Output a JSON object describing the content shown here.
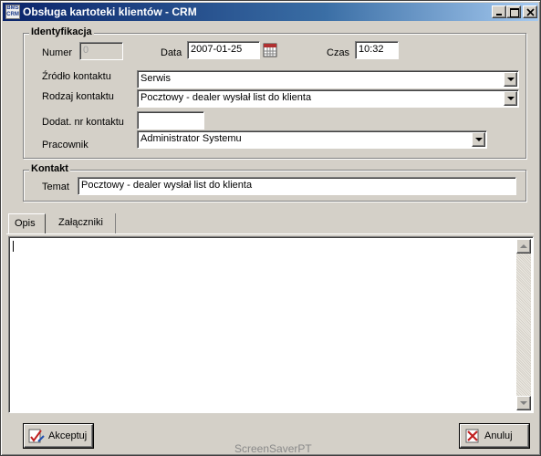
{
  "window": {
    "title": "Obsługa kartoteki klientów - CRM",
    "icon_lines": [
      "BMS",
      "CRM"
    ]
  },
  "identyfikacja": {
    "group_title": "Identyfikacja",
    "numer_label": "Numer",
    "numer_value": "0",
    "data_label": "Data",
    "data_value": "2007-01-25",
    "czas_label": "Czas",
    "czas_value": "10:32",
    "zrodlo_label": "Źródło kontaktu",
    "zrodlo_value": "Serwis",
    "rodzaj_label": "Rodzaj kontaktu",
    "rodzaj_value": "Pocztowy - dealer wysłał list do klienta",
    "dodat_label": "Dodat. nr kontaktu",
    "dodat_value": "",
    "pracownik_label": "Pracownik",
    "pracownik_value": "Administrator Systemu"
  },
  "kontakt": {
    "group_title": "Kontakt",
    "temat_label": "Temat",
    "temat_value": "Pocztowy - dealer wysłał list do klienta"
  },
  "tabs": [
    {
      "label": "Opis",
      "active": true
    },
    {
      "label": "Załączniki",
      "active": false
    }
  ],
  "memo": {
    "value": ""
  },
  "buttons": {
    "accept_label": "Akceptuj",
    "cancel_label": "Anuluj"
  },
  "watermark": "ScreenSaverPT",
  "colors": {
    "title_gradient_start": "#0a246a",
    "title_gradient_end": "#a6caf0",
    "face": "#d4d0c8"
  },
  "icons": {
    "app": "crm-app-icon",
    "calendar": "calendar-icon",
    "accept": "checkmark-pencil-icon",
    "cancel": "cancel-x-icon"
  }
}
